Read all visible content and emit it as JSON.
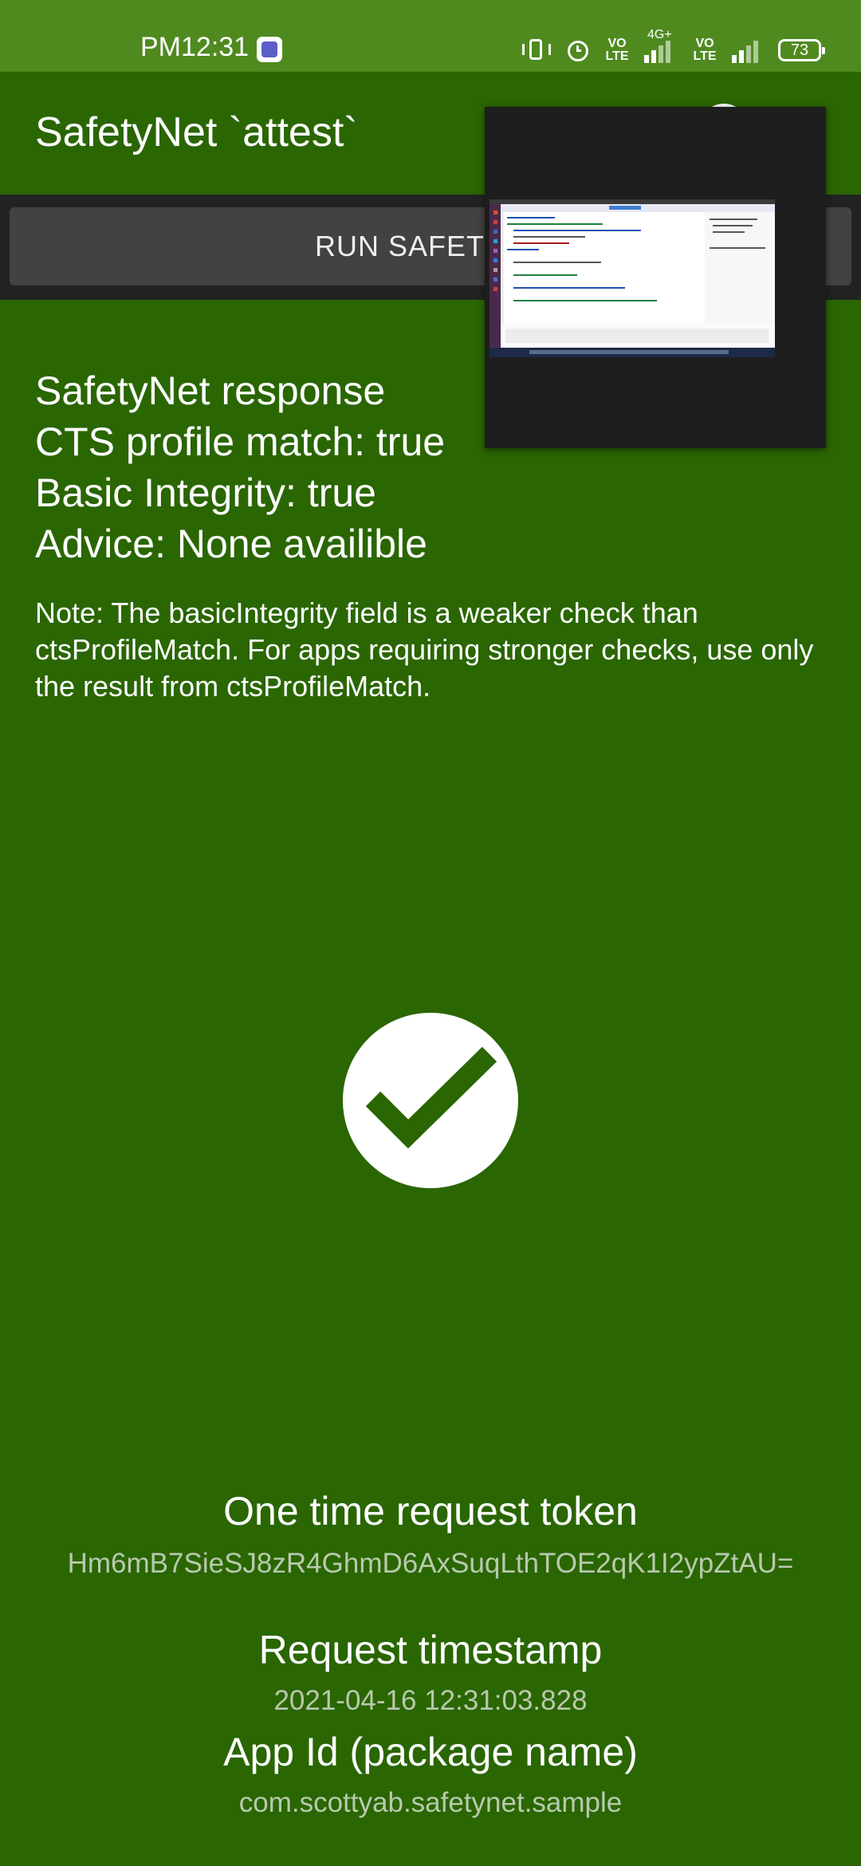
{
  "status_bar": {
    "time": "PM12:31",
    "network_type": "4G+",
    "volte_1": "VO LTE",
    "volte_2": "VO LTE",
    "battery_level": "73"
  },
  "app_bar": {
    "title": "SafetyNet `attest`",
    "icons": [
      "info-icon",
      "more-icon"
    ]
  },
  "toolbar": {
    "run_button_label": "RUN SAFETYNE"
  },
  "result": {
    "heading": "SafetyNet response",
    "cts_profile_match": "CTS profile match: true",
    "basic_integrity": "Basic Integrity: true",
    "advice": "Advice: None availible",
    "note": "Note: The basicIntegrity field is a weaker check than ctsProfileMatch. For apps requiring stronger checks, use only the result from ctsProfileMatch.",
    "status_icon": "check-circle-icon",
    "status_color": "#ffffff"
  },
  "details": {
    "token_label": "One time request token",
    "token_value": "Hm6mB7SieSJ8zR4GhmD6AxSuqLthTOE2qK1I2ypZtAU=",
    "timestamp_label": "Request timestamp",
    "timestamp_value": "2021-04-16 12:31:03.828",
    "app_id_label": "App Id (package name)",
    "app_id_value": "com.scottyab.safetynet.sample"
  },
  "colors": {
    "background": "#2a6602",
    "status_bar": "#4f8a1f",
    "button_band": "#222222",
    "button": "#424242",
    "secondary_text": "#b9c9ae"
  }
}
